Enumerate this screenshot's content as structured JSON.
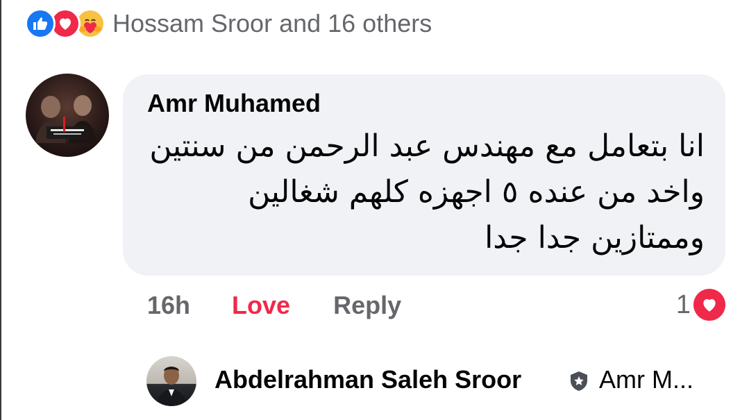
{
  "reactions": {
    "icons": [
      "like-icon",
      "love-icon",
      "care-icon"
    ],
    "summary": "Hossam Sroor and 16 others"
  },
  "comment": {
    "author": "Amr Muhamed",
    "text": "انا بتعامل مع مهندس عبد الرحمن من سنتين واخد من عنده ٥ اجهزه كلهم شغالين وممتازين جدا جدا",
    "time": "16h",
    "love_label": "Love",
    "reply_label": "Reply",
    "reaction_count": "1",
    "reaction_icon": "love-icon"
  },
  "reply": {
    "author": "Abdelrahman Saleh Sroor",
    "badge_icon": "shield-badge-icon",
    "replying_to": "Amr M..."
  },
  "colors": {
    "like": "#1877f2",
    "love": "#f0284a",
    "care": "#f7c244",
    "bubble": "#f0f2f5",
    "muted": "#65676b",
    "text": "#050505"
  }
}
